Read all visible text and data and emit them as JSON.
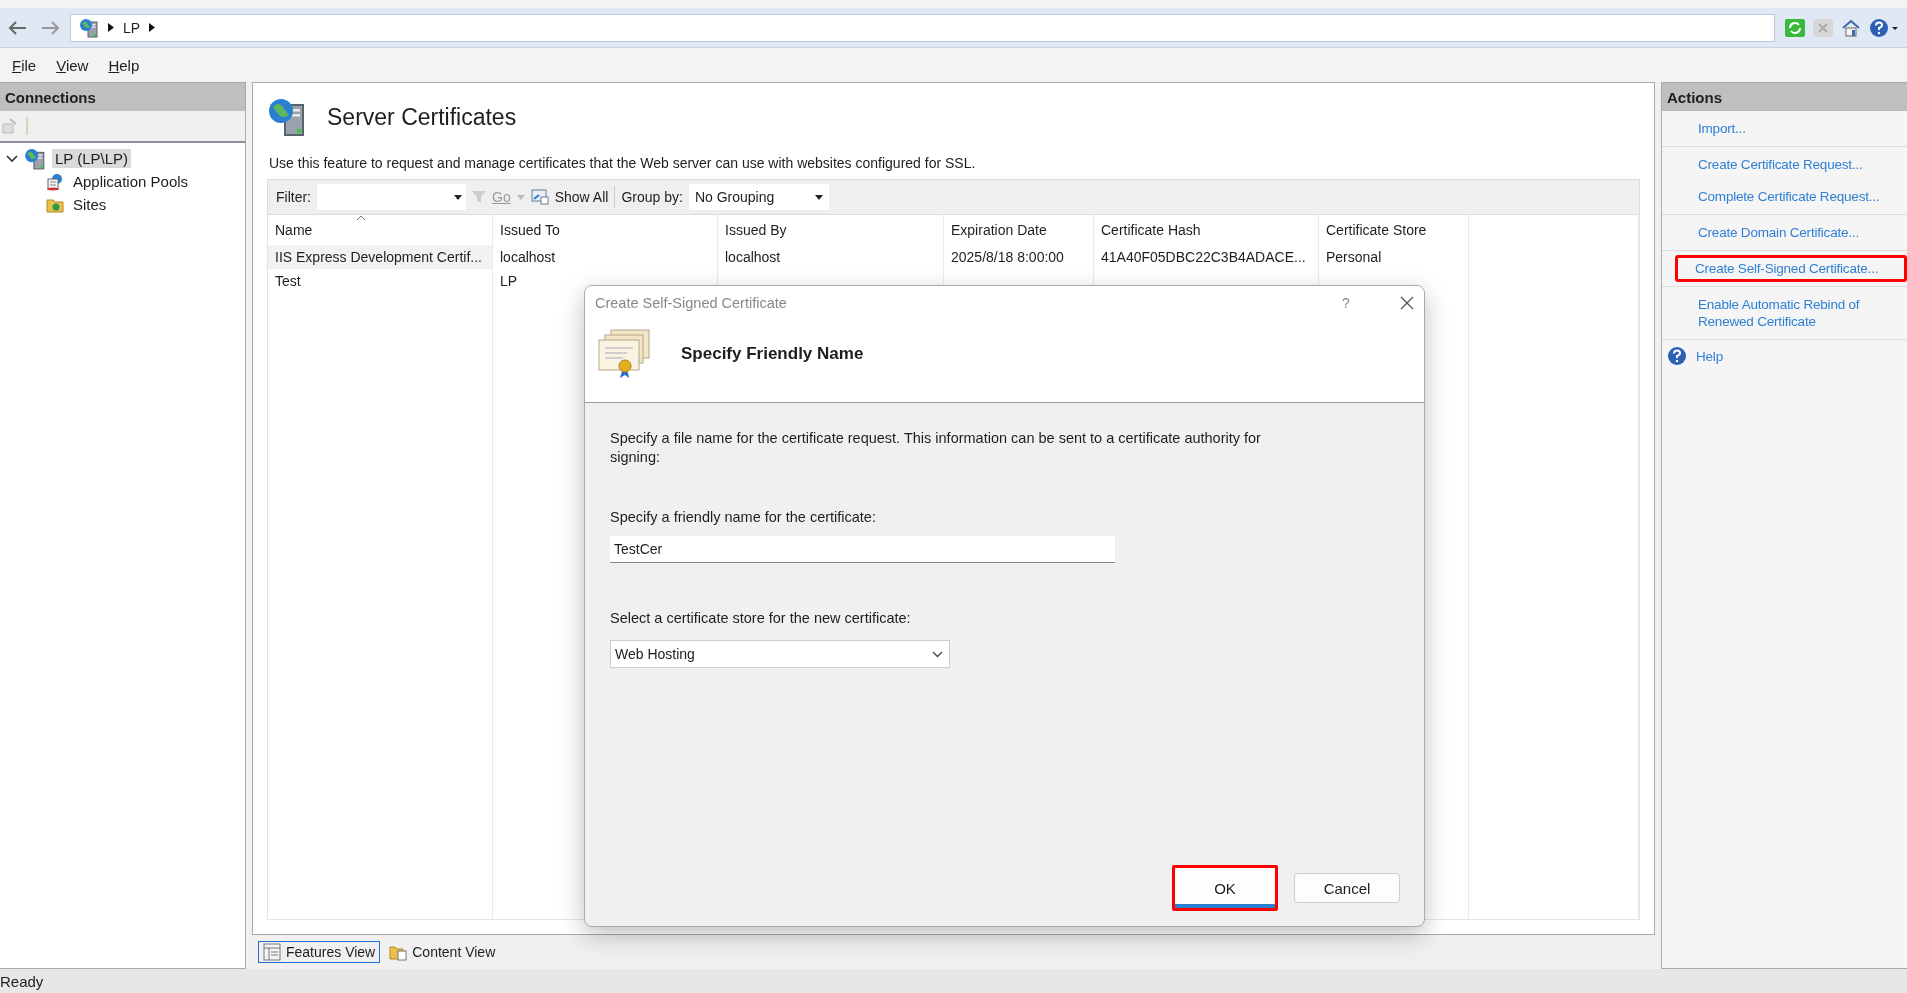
{
  "address_bar": {
    "path": [
      "LP"
    ]
  },
  "menu": [
    {
      "label": "File"
    },
    {
      "label": "View"
    },
    {
      "label": "Help"
    }
  ],
  "connections": {
    "title": "Connections",
    "tree": [
      {
        "label": "LP (LP\\LP)",
        "selected": true,
        "expanded": true,
        "children": [
          {
            "label": "Application Pools",
            "selected": false
          },
          {
            "label": "Sites",
            "selected": false
          }
        ]
      }
    ]
  },
  "feature": {
    "title": "Server Certificates",
    "description": "Use this feature to request and manage certificates that the Web server can use with websites configured for SSL.",
    "filter": {
      "label": "Filter:",
      "go": "Go",
      "show_all": "Show All",
      "group_by_label": "Group by:",
      "group_by": "No Grouping"
    },
    "table": {
      "columns": [
        "Name",
        "Issued To",
        "Issued By",
        "Expiration Date",
        "Certificate Hash",
        "Certificate Store"
      ],
      "rows": [
        [
          "IIS Express Development Certif...",
          "localhost",
          "localhost",
          "2025/8/18 8:00:00",
          "41A40F05DBC22C3B4ADACE...",
          "Personal"
        ],
        [
          "Test",
          "LP"
        ]
      ]
    }
  },
  "view_tabs": [
    {
      "label": "Features View",
      "selected": true
    },
    {
      "label": "Content View",
      "selected": false
    }
  ],
  "actions": {
    "title": "Actions",
    "groups": [
      [
        {
          "label": "Import...",
          "highlighted": false
        }
      ],
      [
        {
          "label": "Create Certificate Request...",
          "highlighted": false
        },
        {
          "label": "Complete Certificate Request...",
          "highlighted": false
        }
      ],
      [
        {
          "label": "Create Domain Certificate...",
          "highlighted": false
        }
      ],
      [
        {
          "label": "Create Self-Signed Certificate...",
          "highlighted": true
        }
      ],
      [
        {
          "label": "Enable Automatic Rebind of Renewed Certificate",
          "highlighted": false
        }
      ]
    ],
    "help": "Help"
  },
  "dialog": {
    "title": "Create Self-Signed Certificate",
    "help_glyph": "?",
    "heading": "Specify Friendly Name",
    "intro": "Specify a file name for the certificate request.  This information can be sent to a certificate authority for signing:",
    "name_label": "Specify a friendly name for the certificate:",
    "name_value": "TestCer",
    "store_label": "Select a certificate store for the new certificate:",
    "store_value": "Web Hosting",
    "buttons": [
      {
        "label": "OK",
        "highlighted": true
      },
      {
        "label": "Cancel",
        "highlighted": false
      }
    ]
  },
  "status_bar": "Ready"
}
